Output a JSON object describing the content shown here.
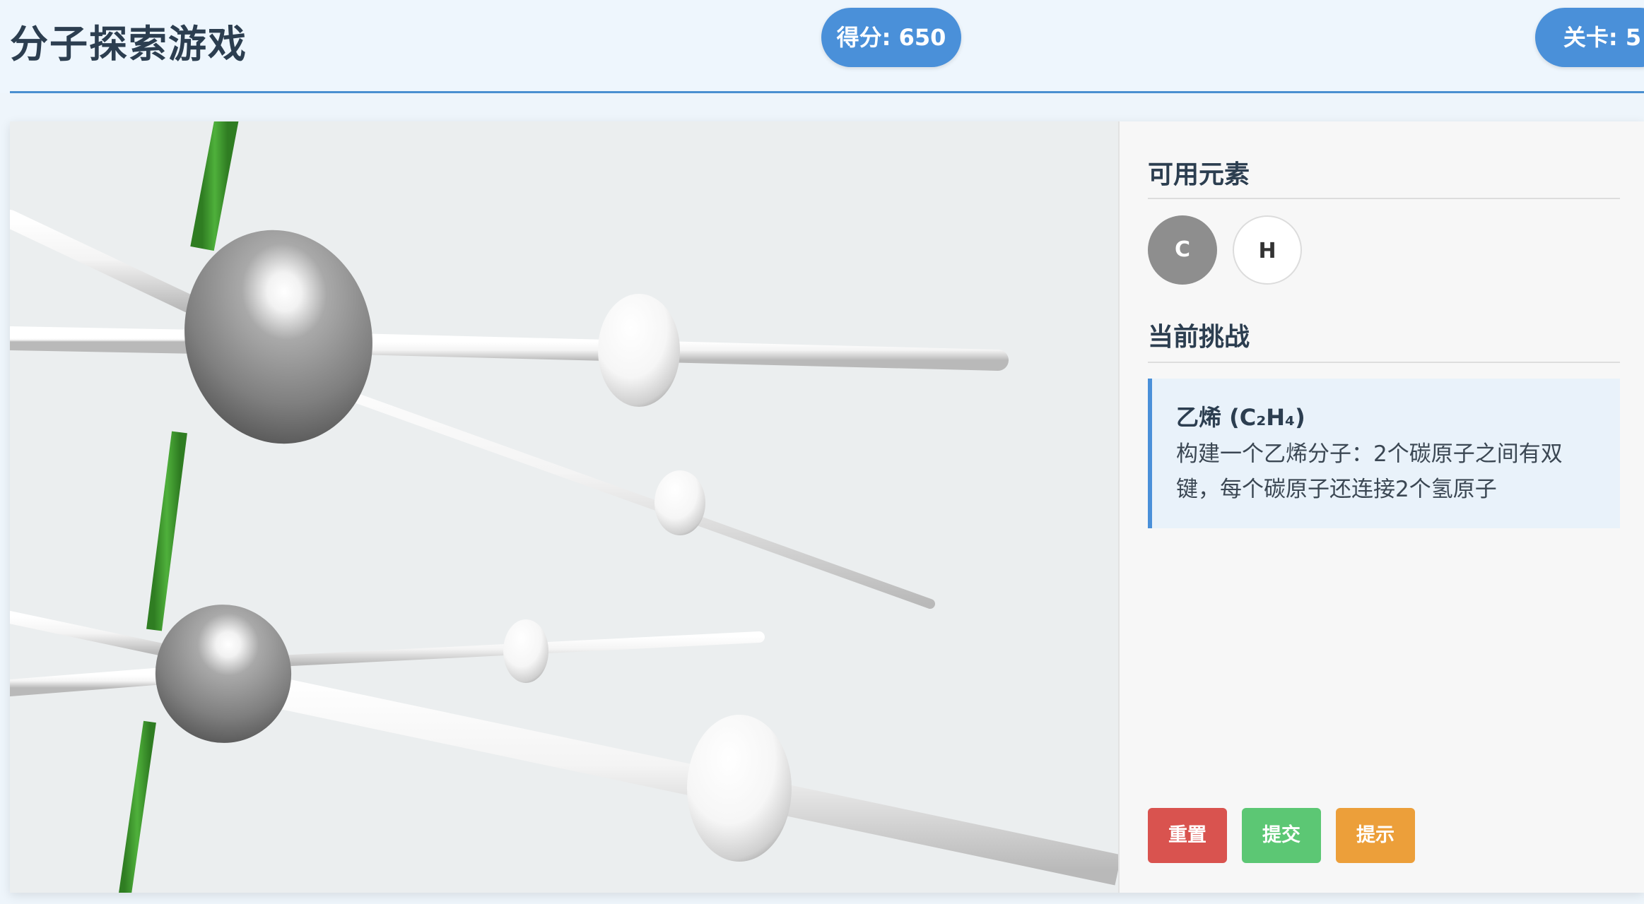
{
  "header": {
    "title": "分子探索游戏",
    "score_label": "得分: 650",
    "level_label": "关卡: 5"
  },
  "panel": {
    "elements_title": "可用元素",
    "elements": [
      {
        "symbol": "C",
        "color": "#8e8e8e"
      },
      {
        "symbol": "H",
        "color": "#ffffff"
      }
    ],
    "challenge_title": "当前挑战",
    "challenge": {
      "name": "乙烯 (C₂H₄)",
      "description_line1": "构建一个乙烯分子：2个碳原子之间有双",
      "description_line2": "键，每个碳原子还连接2个氢原子"
    }
  },
  "buttons": {
    "reset": "重置",
    "submit": "提交",
    "hint": "提示"
  },
  "colors": {
    "accent": "#4a90d9",
    "double_bond": "#3f9b2e",
    "carbon": "#8e8e8e",
    "hydrogen": "#ffffff",
    "reset": "#d9534f",
    "submit": "#5cc774",
    "hint": "#ec9f3a"
  }
}
